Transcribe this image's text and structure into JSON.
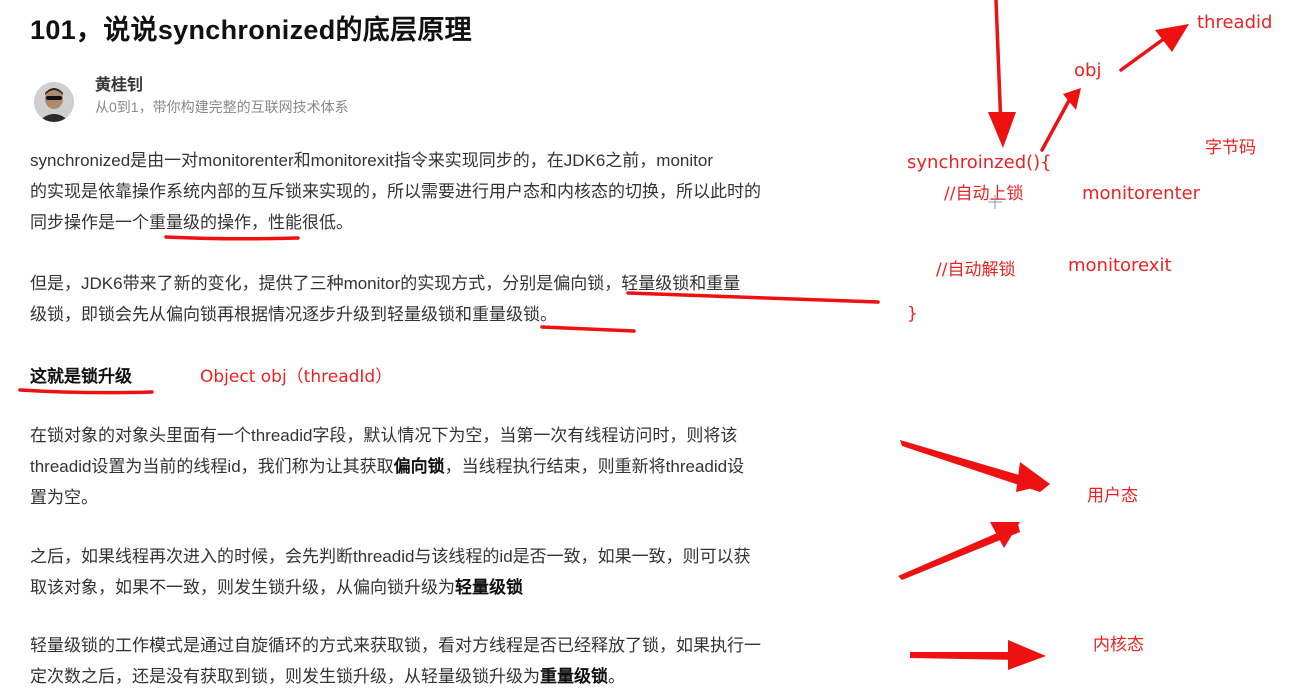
{
  "article": {
    "title": "101，说说synchronized的底层原理",
    "author": {
      "name": "黄桂钊",
      "bio": "从0到1，带你构建完整的互联网技术体系"
    },
    "p1": {
      "line1": "synchronized是由一对monitorenter和monitorexit指令来实现同步的，在JDK6之前，monitor",
      "line2": "的实现是依靠操作系统内部的互斥锁来实现的，所以需要进行用户态和内核态的切换，所以此时的",
      "line3_a": "同步操作是一个",
      "line3_b": "重量级的操作",
      "line3_c": "，性能很低。"
    },
    "p2": {
      "line1": "但是，JDK6带来了新的变化，提供了三种monitor的实现方式，分别是偏向锁，轻量级锁和重量",
      "line2": "级锁，即锁会先从偏向锁再根据情况逐步升级到轻量级锁和重量级锁。"
    },
    "heading": "这就是锁升级",
    "p4": {
      "line1": "在锁对象的对象头里面有一个threadid字段，默认情况下为空，当第一次有线程访问时，则将该",
      "line2_a": "threadid设置为当前的线程id，我们称为让其获取",
      "line2_b": "偏向锁",
      "line2_c": "，当线程执行结束，则重新将threadid设",
      "line3": "置为空。"
    },
    "p5": {
      "line1": "之后，如果线程再次进入的时候，会先判断threadid与该线程的id是否一致，如果一致，则可以获",
      "line2_a": "取该对象，如果不一致，则发生锁升级，从偏向锁升级为",
      "line2_b": "轻量级锁"
    },
    "p6": {
      "line1": "轻量级锁的工作模式是通过自旋循环的方式来获取锁，看对方线程是否已经释放了锁，如果执行一",
      "line2_a": "定次数之后，还是没有获取到锁，则发生锁升级，从轻量级锁升级为",
      "line2_b": "重量级锁",
      "line2_c": "。"
    }
  },
  "annotations": {
    "object_obj": "Object obj（threadId）",
    "threadid": "threadid",
    "obj": "obj",
    "bytecode": "字节码",
    "sync_open": "synchroinzed(){",
    "auto_lock": "//自动上锁",
    "monitorenter": "monitorenter",
    "auto_unlock": "//自动解锁",
    "monitorexit": "monitorexit",
    "brace_close": "}",
    "user_mode": "用户态",
    "kernel_mode": "内核态"
  },
  "colors": {
    "annotation": "#ee2222",
    "text": "#333333",
    "title": "#111111",
    "muted": "#888888"
  },
  "icons": {
    "avatar": "author-avatar",
    "cursor": "crosshair-cursor-icon"
  }
}
